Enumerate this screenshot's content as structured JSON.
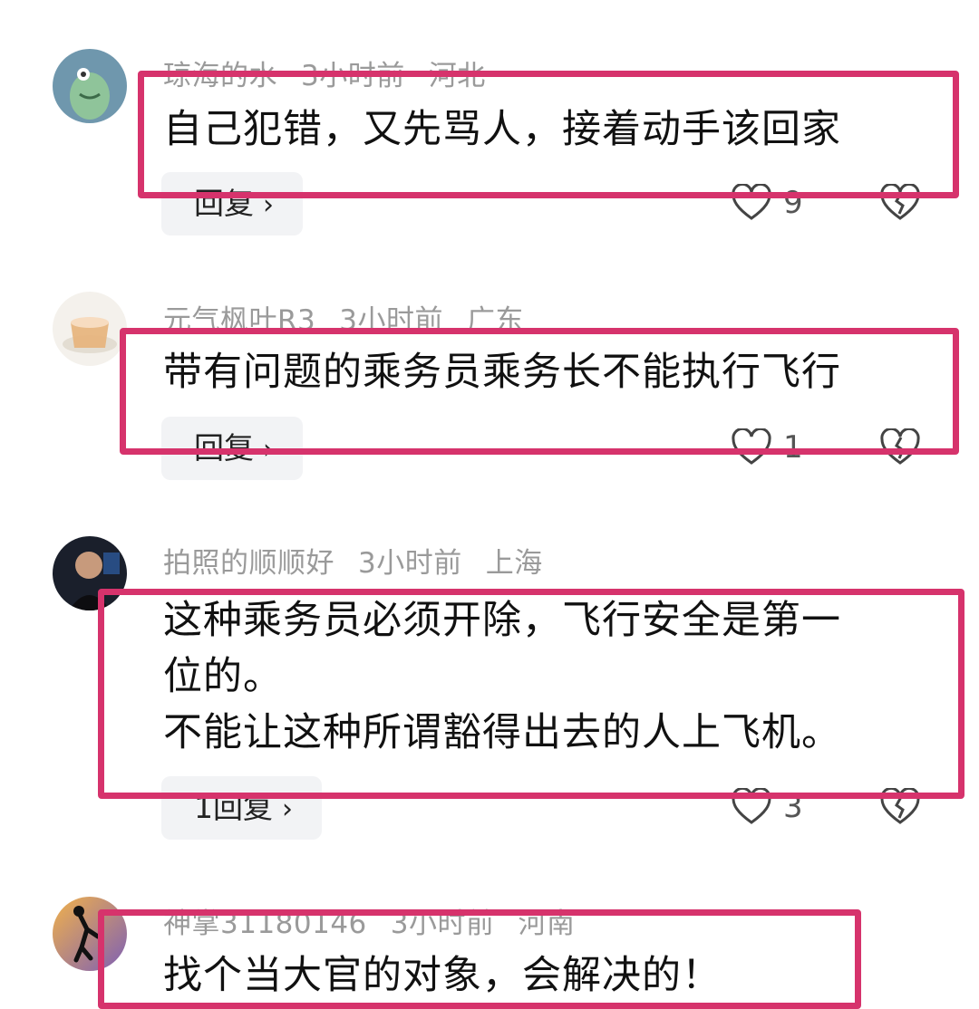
{
  "comments": [
    {
      "username": "琼海的水",
      "time": "3小时前",
      "location": "河北",
      "lines": [
        "自己犯错，又先骂人，接着动手该回家"
      ],
      "reply_label": "回复",
      "likes": "9"
    },
    {
      "username": "元气枫叶R3",
      "time": "3小时前",
      "location": "广东",
      "lines": [
        "带有问题的乘务员乘务长不能执行飞行"
      ],
      "reply_label": "回复",
      "likes": "1"
    },
    {
      "username": "拍照的顺顺好",
      "time": "3小时前",
      "location": "上海",
      "lines": [
        "这种乘务员必须开除，飞行安全是第一",
        "位的。",
        "不能让这种所谓豁得出去的人上飞机。"
      ],
      "reply_label": "1回复",
      "likes": "3"
    },
    {
      "username": "神掌31180146",
      "time": "3小时前",
      "location": "河南",
      "lines": [
        "找个当大官的对象，会解决的！"
      ]
    }
  ],
  "colors": {
    "highlight": "#d6336c",
    "meta": "#9a9a9a",
    "reply_bg": "#f2f3f5"
  },
  "icons": {
    "like": "heart-icon",
    "dislike": "broken-heart-icon",
    "reply_chevron": "chevron-right-icon"
  }
}
